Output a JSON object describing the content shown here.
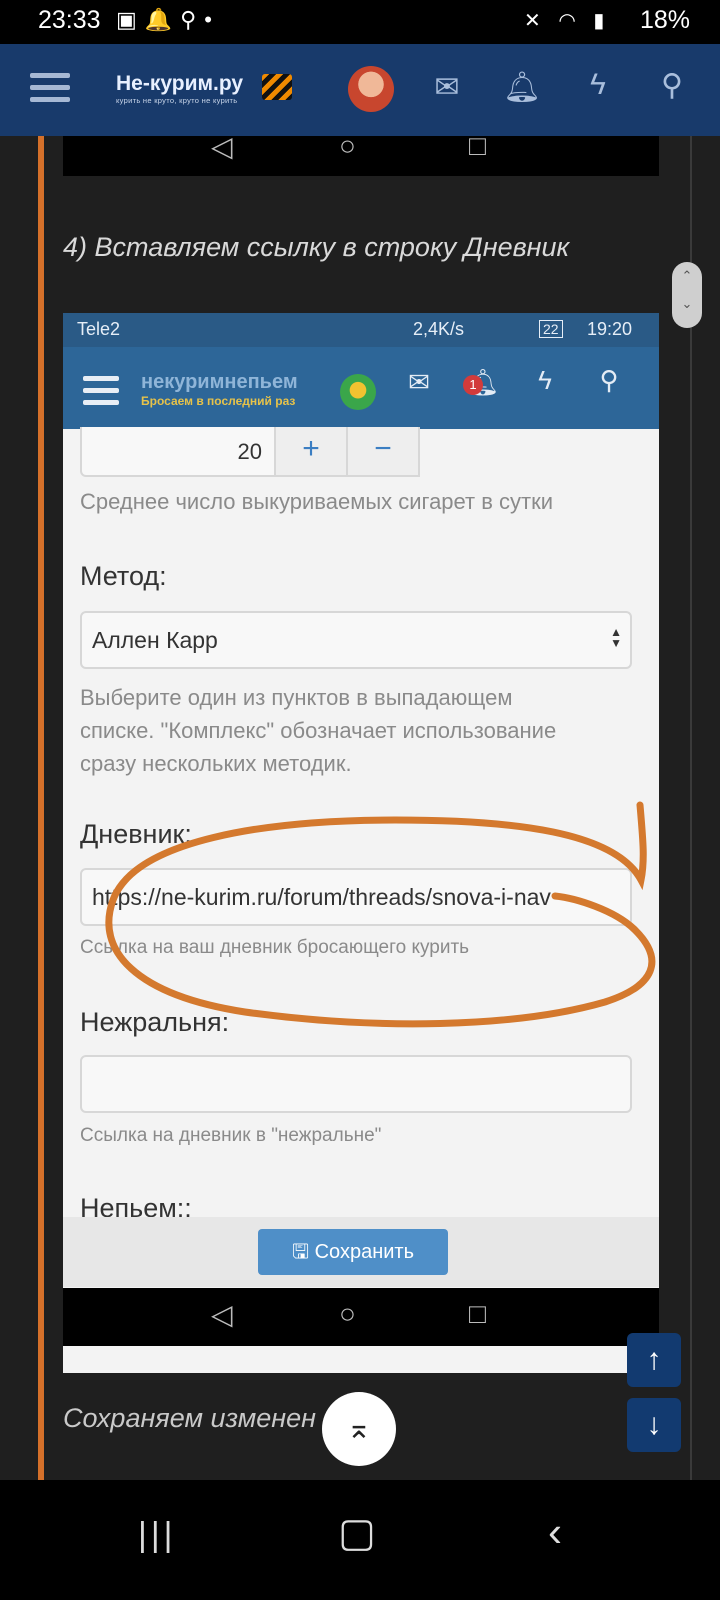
{
  "status_bar": {
    "time": "23:33",
    "battery": "18%"
  },
  "outer_site": {
    "logo_title": "Не-курим.ру",
    "logo_slogan": "курить не круто, круто не курить"
  },
  "article": {
    "step_heading": "4) Вставляем ссылку в строку Дневник",
    "bottom_caption": "Сохраняем изменен"
  },
  "inner_screenshot": {
    "status": {
      "carrier": "Tele2",
      "speed": "2,4K/s",
      "battery": "22",
      "time": "19:20"
    },
    "logo_title": "некуримнепьем",
    "logo_slogan": "Бросаем в последний раз",
    "message_badge": "1",
    "cigarettes": {
      "value": "20",
      "plus_label": "+",
      "minus_label": "−",
      "hint": "Среднее число выкуриваемых сигарет в сутки"
    },
    "method": {
      "label": "Метод:",
      "value": "Аллен Карр",
      "hint_lines": [
        "Выберите один из пунктов в выпадающем",
        "списке. \"Комплекс\" обозначает использование",
        "сразу нескольких методик."
      ]
    },
    "diary": {
      "label": "Дневник:",
      "value": "https://ne-kurim.ru/forum/threads/snova-i-nav",
      "hint": "Ссылка на ваш дневник бросающего курить"
    },
    "nezhralnya": {
      "label": "Нежральня:",
      "value": "",
      "hint": "Ссылка на дневник в \"нежральне\""
    },
    "nepyem": {
      "label": "Непьем::"
    },
    "save_label": "Сохранить"
  },
  "colors": {
    "header_blue": "#183a6b",
    "inner_header_blue": "#2d6698",
    "accent_orange": "#d4702a",
    "save_blue": "#4f8fc8"
  }
}
